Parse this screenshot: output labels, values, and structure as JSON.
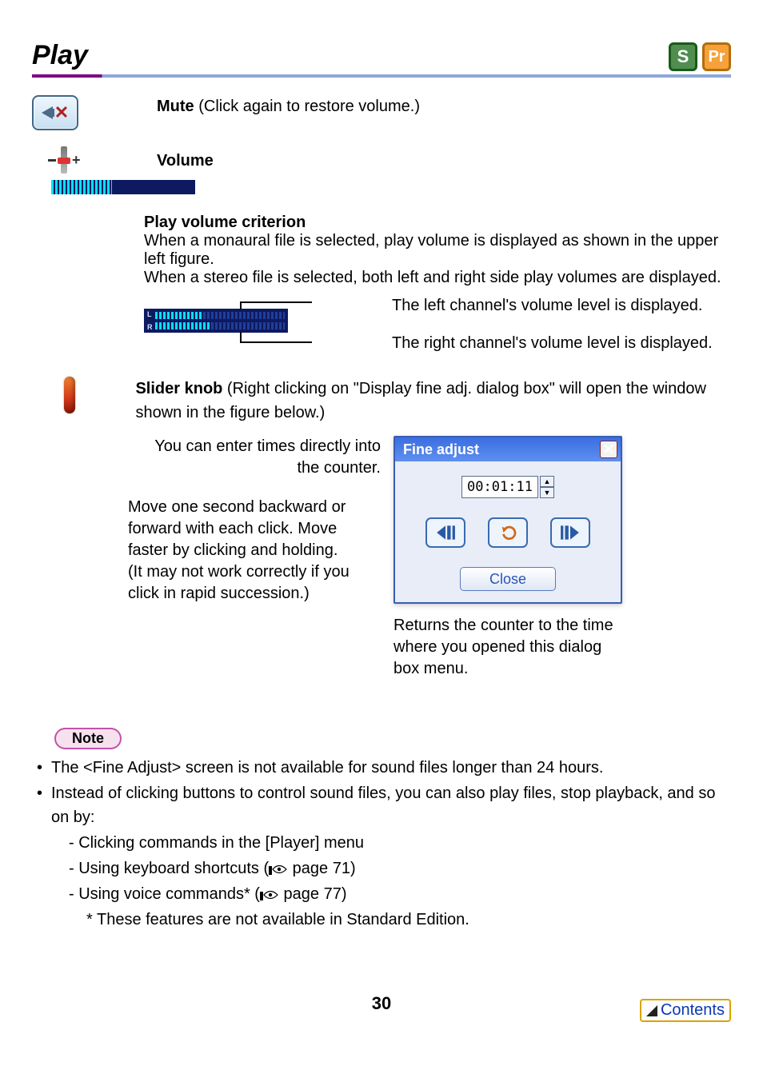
{
  "header": {
    "title": "Play",
    "badges": {
      "s": "S",
      "pr": "Pr"
    }
  },
  "mute": {
    "label": "Mute",
    "desc": " (Click again to restore volume.)"
  },
  "volume": {
    "label": "Volume"
  },
  "pvc": {
    "heading": "Play volume criterion",
    "p1": "When a monaural file is selected, play volume is displayed as shown in the upper left figure.",
    "p2": "When a stereo file is selected, both left and right side play volumes are displayed.",
    "leftLabel": "The left channel's volume level is displayed.",
    "rightLabel": "The right channel's volume level is displayed."
  },
  "slider": {
    "label": "Slider knob",
    "desc": " (Right clicking on \"Display fine adj. dialog box\" will open the window shown in the figure below.)"
  },
  "anno": {
    "enterTime": "You can enter times directly into the counter.",
    "move": "Move one second backward or forward with each click. Move faster by clicking and holding.\n(It may not work correctly if you click in rapid succession.)",
    "reset": "Returns the counter to the time where you opened this dialog box menu."
  },
  "fineAdjust": {
    "title": "Fine adjust",
    "counter": "00:01:11",
    "close": "Close"
  },
  "note": {
    "badge": "Note",
    "b1": "The <Fine Adjust> screen is not available for sound files longer than 24 hours.",
    "b2": "Instead of clicking buttons to control sound files, you can also play files, stop playback, and so on by:",
    "s1": "- Clicking commands in the [Player] menu",
    "s2a": "- Using keyboard shortcuts (",
    "s2b": " page 71)",
    "s3a": "- Using voice commands* (",
    "s3b": " page 77)",
    "foot": "* These features are not available in Standard Edition."
  },
  "footer": {
    "page": "30",
    "contents": "Contents"
  }
}
